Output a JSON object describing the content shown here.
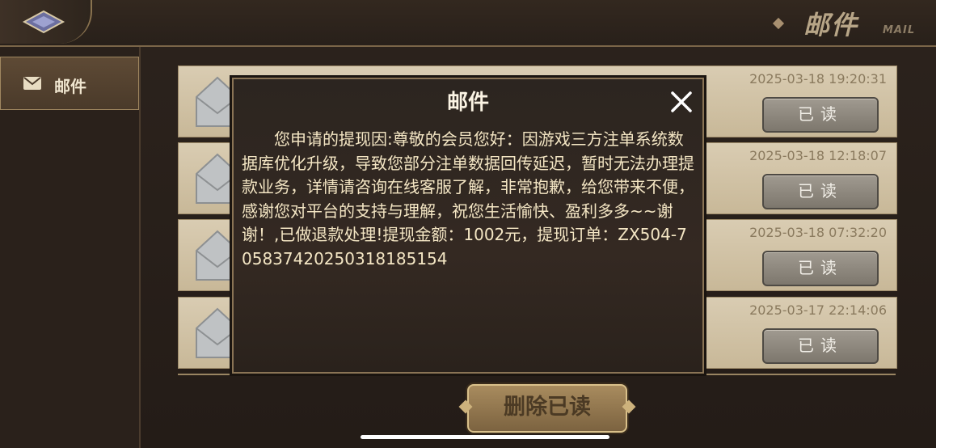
{
  "header": {
    "title": "邮件",
    "subtitle": "MAIL",
    "back_icon": "back-arrow-icon"
  },
  "sidebar": {
    "items": [
      {
        "label": "邮件",
        "icon": "mail-icon",
        "active": true
      }
    ]
  },
  "mails": [
    {
      "time": "2025-03-18 19:20:31",
      "status": "已读"
    },
    {
      "time": "2025-03-18 12:18:07",
      "status": "已读"
    },
    {
      "time": "2025-03-18 07:32:20",
      "status": "已读"
    },
    {
      "time": "2025-03-17 22:14:06",
      "status": "已读"
    }
  ],
  "footer": {
    "delete_read_label": "删除已读"
  },
  "dialog": {
    "title": "邮件",
    "body": "您申请的提现因:尊敬的会员您好：因游戏三方注单系统数据库优化升级，导致您部分注单数据回传延迟，暂时无法办理提款业务，详情请咨询在线客服了解，非常抱歉，给您带来不便，感谢您对平台的支持与理解，祝您生活愉快、盈利多多~~谢谢！,已做退款处理!提现金额：1002元，提现订单：ZX504-70583742025031818515​4",
    "close_icon": "close-icon"
  },
  "colors": {
    "accent": "#a08760",
    "row_bg": "#d0c2a4",
    "dialog_text": "#f4e6c4"
  }
}
